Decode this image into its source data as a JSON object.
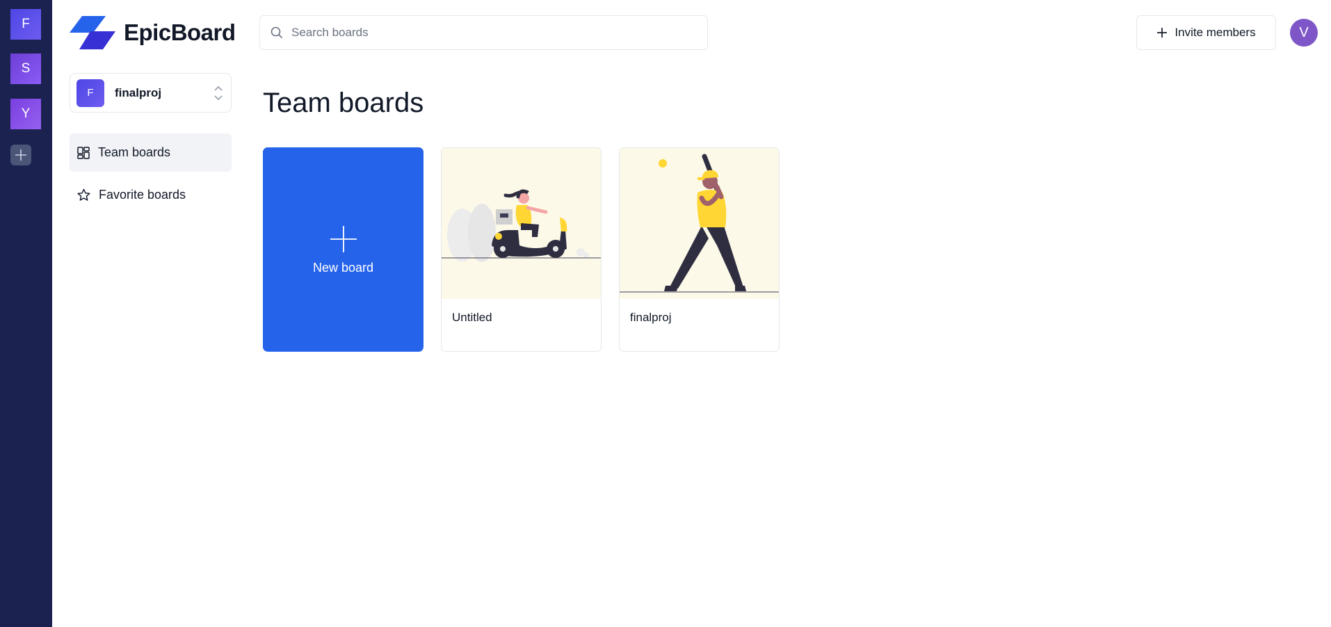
{
  "app": {
    "name": "EpicBoard"
  },
  "org_rail": {
    "orgs": [
      {
        "initial": "F",
        "color": "#5b4ff0"
      },
      {
        "initial": "S",
        "color": "#7c4ee8"
      },
      {
        "initial": "Y",
        "color": "#8a52ec"
      }
    ]
  },
  "sidebar": {
    "org_switcher": {
      "initial": "F",
      "name": "finalproj"
    },
    "nav": [
      {
        "label": "Team boards",
        "icon": "dashboard-icon",
        "active": true
      },
      {
        "label": "Favorite boards",
        "icon": "star-icon",
        "active": false
      }
    ]
  },
  "header": {
    "search": {
      "placeholder": "Search boards",
      "value": ""
    },
    "invite_label": "Invite members",
    "user_initial": "V"
  },
  "main": {
    "title": "Team boards",
    "new_board_label": "New board",
    "boards": [
      {
        "name": "Untitled",
        "thumbnail": "scooter-rider-illustration"
      },
      {
        "name": "finalproj",
        "thumbnail": "baseball-batter-illustration"
      }
    ]
  },
  "colors": {
    "rail_bg": "#1b2250",
    "accent": "#2563eb",
    "thumb_bg": "#fdf9e8"
  }
}
